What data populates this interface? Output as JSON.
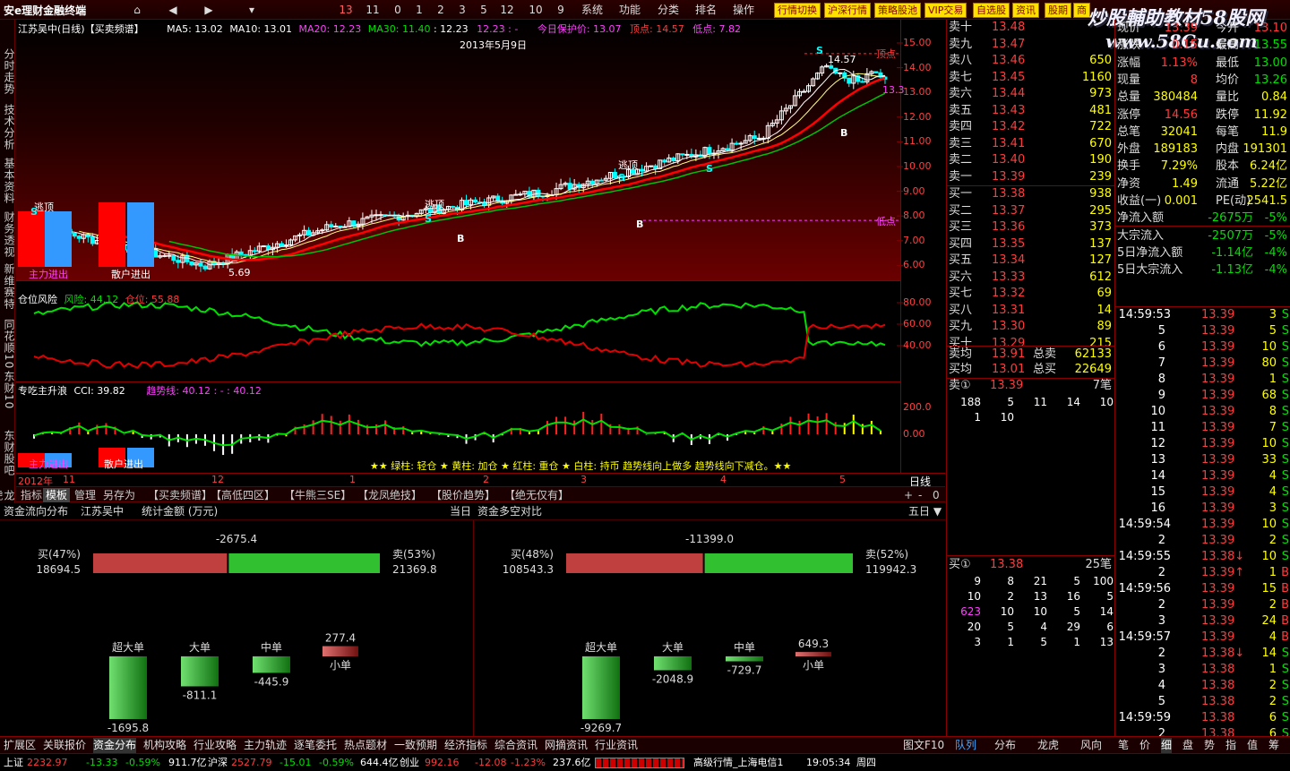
{
  "topbar": {
    "logo": "安e理财金融终端",
    "nums": [
      "13",
      "11",
      "0",
      "1",
      "2",
      "3",
      "5",
      "12",
      "10",
      "9"
    ],
    "menus": [
      "系统",
      "功能",
      "分类",
      "排名",
      "操作"
    ],
    "yellow_buttons": [
      "行情切换",
      "沪深行情",
      "策略股池",
      "VIP交易",
      "自选股",
      "资讯",
      "股期",
      "商"
    ],
    "watermark_line1": "炒股輔助教材58股网",
    "watermark_line2": "www.58Gu.com"
  },
  "left_tabs": [
    "分时走势",
    "技术分析",
    "基本资料",
    "财务透视",
    "新维赛特",
    "同花顺10",
    "东财10",
    "东财股吧",
    "龙虎榜"
  ],
  "chart": {
    "title": "江苏吴中(日线)【买卖频谱】",
    "ma5": "MA5: 13.02",
    "ma10": "MA10: 13.01",
    "ma20": "MA20: 12.23",
    "ma30": "MA30: 11.40",
    "ma_extra": ": 12.23",
    "ma_extra2": "12.23 : -",
    "protect": "今日保护价: 13.07",
    "top_point": "顶点: 14.57",
    "low_point": "低点: 7.82",
    "date_label": "2013年5月9日",
    "price_labels": [
      "15.00",
      "14.00",
      "13.00",
      "12.00",
      "11.00",
      "10.00",
      "9.00",
      "8.00",
      "7.00",
      "6.00"
    ],
    "annot_escape": "逃顶",
    "annot_top": "顶点",
    "annot_low": "低点",
    "annot_main": "主力进出",
    "annot_retail": "散户进出",
    "annot_min": "5.69",
    "annot_max": "14.57",
    "annot_b": "B",
    "annot_s": "S",
    "annot_right": "13.3",
    "risk_title": "仓位风险",
    "risk_val": "风险: 44.12",
    "pos_val": "仓位: 55.88",
    "risk_labels": [
      "80.00",
      "60.00",
      "40.00"
    ],
    "cci_title": "专吃主升浪",
    "cci_val": "CCI: 39.82",
    "trend_val": "趋势线: 40.12 : - : 40.12",
    "cci_labels": [
      "200.0",
      "0.00"
    ],
    "cci_note": "★★ 绿柱: 轻仓 ★ 黄柱: 加仓 ★ 红柱: 重仓 ★ 白柱: 持币  趋势线向上做多  趋势线向下减仓。★★",
    "dates": [
      "2012年",
      "11",
      "12",
      "1",
      "2",
      "3",
      "4",
      "5"
    ],
    "period": "日线",
    "tabs": [
      "指标",
      "模板",
      "管理",
      "另存为",
      "【买卖频谱】",
      "【高低四区】",
      "【牛熊三SE】",
      "【龙凤绝技】",
      "【股价趋势】",
      "【绝无仅有】"
    ],
    "zoom": [
      "+",
      "-",
      "0"
    ]
  },
  "flow": {
    "title": "资金流向分布",
    "stock": "江苏吴中",
    "unit": "统计金额 (万元)",
    "day": "当日",
    "compare_title": "资金多空对比",
    "five_day": "五日",
    "left": {
      "net": "-2675.4",
      "buy_label": "买(47%)",
      "buy_val": "18694.5",
      "sell_label": "卖(53%)",
      "sell_val": "21369.8",
      "buy_pct": 47,
      "bars": [
        {
          "label": "超大单",
          "val": "-1695.8",
          "amount": -1695.8
        },
        {
          "label": "大单",
          "val": "-811.1",
          "amount": -811.1
        },
        {
          "label": "中单",
          "val": "-445.9",
          "amount": -445.9
        },
        {
          "label": "小单",
          "val": "277.4",
          "amount": 277.4
        }
      ]
    },
    "right": {
      "net": "-11399.0",
      "buy_label": "买(48%)",
      "buy_val": "108543.3",
      "sell_label": "卖(52%)",
      "sell_val": "119942.3",
      "buy_pct": 48,
      "bars": [
        {
          "label": "超大单",
          "val": "-9269.7",
          "amount": -9269.7
        },
        {
          "label": "大单",
          "val": "-2048.9",
          "amount": -2048.9
        },
        {
          "label": "中单",
          "val": "-729.7",
          "amount": -729.7
        },
        {
          "label": "小单",
          "val": "649.3",
          "amount": 649.3
        }
      ]
    }
  },
  "orderbook": {
    "sells": [
      {
        "name": "卖十",
        "price": "13.48",
        "vol": ""
      },
      {
        "name": "卖九",
        "price": "13.47",
        "vol": ""
      },
      {
        "name": "卖八",
        "price": "13.46",
        "vol": "650"
      },
      {
        "name": "卖七",
        "price": "13.45",
        "vol": "1160"
      },
      {
        "name": "卖六",
        "price": "13.44",
        "vol": "973"
      },
      {
        "name": "卖五",
        "price": "13.43",
        "vol": "481"
      },
      {
        "name": "卖四",
        "price": "13.42",
        "vol": "722"
      },
      {
        "name": "卖三",
        "price": "13.41",
        "vol": "670"
      },
      {
        "name": "卖二",
        "price": "13.40",
        "vol": "190"
      },
      {
        "name": "卖一",
        "price": "13.39",
        "vol": "239"
      }
    ],
    "buys": [
      {
        "name": "买一",
        "price": "13.38",
        "vol": "938"
      },
      {
        "name": "买二",
        "price": "13.37",
        "vol": "295"
      },
      {
        "name": "买三",
        "price": "13.36",
        "vol": "373"
      },
      {
        "name": "买四",
        "price": "13.35",
        "vol": "137"
      },
      {
        "name": "买五",
        "price": "13.34",
        "vol": "127"
      },
      {
        "name": "买六",
        "price": "13.33",
        "vol": "612"
      },
      {
        "name": "买七",
        "price": "13.32",
        "vol": "69"
      },
      {
        "name": "买八",
        "price": "13.31",
        "vol": "14"
      },
      {
        "name": "买九",
        "price": "13.30",
        "vol": "89"
      },
      {
        "name": "买十",
        "price": "13.29",
        "vol": "215"
      }
    ],
    "sell_avg_label": "卖均",
    "sell_avg": "13.91",
    "sell_total_label": "总卖",
    "sell_total": "62133",
    "buy_avg_label": "买均",
    "buy_avg": "13.01",
    "buy_total_label": "总买",
    "buy_total": "22649",
    "sell1_title": "卖①",
    "sell1_price": "13.39",
    "sell1_count": "7笔",
    "sell1_queue": [
      [
        "188",
        "5",
        "11",
        "14",
        "10"
      ],
      [
        "1",
        "10",
        "",
        "",
        ""
      ]
    ],
    "buy1_title": "买①",
    "buy1_price": "13.38",
    "buy1_count": "25笔",
    "buy1_queue": [
      [
        "9",
        "8",
        "21",
        "5",
        "100"
      ],
      [
        "10",
        "2",
        "13",
        "16",
        "5"
      ],
      [
        "623",
        "10",
        "10",
        "5",
        "14"
      ],
      [
        "20",
        "5",
        "4",
        "29",
        "6"
      ],
      [
        "3",
        "1",
        "5",
        "1",
        "13"
      ]
    ]
  },
  "stats": [
    [
      "现价",
      "13.39",
      "今开",
      "13.10"
    ],
    [
      "涨跌",
      "0.15",
      "最高",
      "13.55"
    ],
    [
      "涨幅",
      "1.13%",
      "最低",
      "13.00"
    ],
    [
      "现量",
      "8",
      "均价",
      "13.26"
    ],
    [
      "总量",
      "380484",
      "量比",
      "0.84"
    ],
    [
      "涨停",
      "14.56",
      "跌停",
      "11.92"
    ],
    [
      "总笔",
      "32041",
      "每笔",
      "11.9"
    ],
    [
      "外盘",
      "189183",
      "内盘",
      "191301"
    ],
    [
      "换手",
      "7.29%",
      "股本",
      "6.24亿"
    ],
    [
      "净资",
      "1.49",
      "流通",
      "5.22亿"
    ],
    [
      "收益(一)",
      "0.001",
      "PE(动)",
      "2541.5"
    ],
    [
      "净流入额",
      "-2675万",
      "-5%",
      ""
    ],
    [
      "大宗流入",
      "-2507万",
      "-5%",
      ""
    ],
    [
      "5日净流入额",
      "-1.14亿",
      "-4%",
      ""
    ],
    [
      "5日大宗流入",
      "-1.13亿",
      "-4%",
      ""
    ]
  ],
  "ticks": [
    [
      "14:59:53",
      "13.39",
      "3",
      "S"
    ],
    [
      "5",
      "13.39",
      "5",
      "S"
    ],
    [
      "6",
      "13.39",
      "10",
      "S"
    ],
    [
      "7",
      "13.39",
      "80",
      "S"
    ],
    [
      "8",
      "13.39",
      "1",
      "S"
    ],
    [
      "9",
      "13.39",
      "68",
      "S"
    ],
    [
      "10",
      "13.39",
      "8",
      "S"
    ],
    [
      "11",
      "13.39",
      "7",
      "S"
    ],
    [
      "12",
      "13.39",
      "10",
      "S"
    ],
    [
      "13",
      "13.39",
      "33",
      "S"
    ],
    [
      "14",
      "13.39",
      "4",
      "S"
    ],
    [
      "15",
      "13.39",
      "4",
      "S"
    ],
    [
      "16",
      "13.39",
      "3",
      "S"
    ],
    [
      "14:59:54",
      "13.39",
      "10",
      "S"
    ],
    [
      "2",
      "13.39",
      "2",
      "S"
    ],
    [
      "14:59:55",
      "13.38↓",
      "10",
      "S"
    ],
    [
      "2",
      "13.39↑",
      "1",
      "B"
    ],
    [
      "14:59:56",
      "13.39",
      "15",
      "B"
    ],
    [
      "2",
      "13.39",
      "2",
      "B"
    ],
    [
      "3",
      "13.39",
      "24",
      "B"
    ],
    [
      "14:59:57",
      "13.39",
      "4",
      "B"
    ],
    [
      "2",
      "13.38↓",
      "14",
      "S"
    ],
    [
      "3",
      "13.38",
      "1",
      "S"
    ],
    [
      "4",
      "13.38",
      "2",
      "S"
    ],
    [
      "5",
      "13.38",
      "2",
      "S"
    ],
    [
      "14:59:59",
      "13.38",
      "6",
      "S"
    ],
    [
      "2",
      "13.38",
      "6",
      "S"
    ]
  ],
  "nav": [
    "扩展区",
    "关联报价",
    "资金分布",
    "机构攻略",
    "行业攻略",
    "主力轨迹",
    "逐笔委托",
    "热点题材",
    "一致预期",
    "经济指标",
    "综合资讯",
    "网摘资讯",
    "行业资讯"
  ],
  "nav_right": [
    "图文F10",
    "队列",
    "分布",
    "龙虎",
    "风向"
  ],
  "nav_icons": [
    "笔",
    "价",
    "细",
    "盘",
    "势",
    "指",
    "值",
    "筹"
  ],
  "status": {
    "sh_name": "上证",
    "sh_idx": "2232.97",
    "sh_chg": "-13.33",
    "sh_pct": "-0.59%",
    "sh_amt": "911.7亿",
    "sz_name": "沪深",
    "sz_idx": "2527.79",
    "sz_chg": "-15.01",
    "sz_pct": "-0.59%",
    "sz_amt": "644.4亿",
    "cy_name": "创业",
    "cy_idx": "992.16",
    "cy_chg": "-12.08",
    "cy_pct": "-1.23%",
    "cy_amt": "237.6亿",
    "feed": "高级行情_上海电信1",
    "time": "19:05:34",
    "weekday": "周四"
  }
}
